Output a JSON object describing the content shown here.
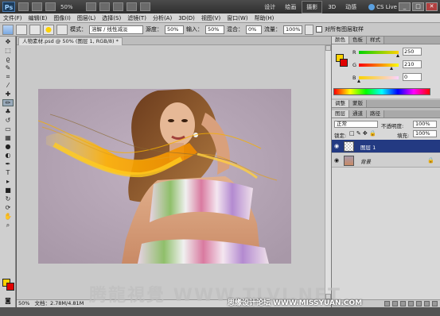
{
  "app": {
    "logo": "Ps",
    "zoom_display": "50%",
    "workspaces": [
      "设计",
      "绘画",
      "摄影",
      "3D",
      "动感"
    ],
    "active_workspace": "摄影",
    "cs_live": "CS Live",
    "window_buttons": [
      "_",
      "□",
      "✕"
    ]
  },
  "menu": [
    "文件(F)",
    "编辑(E)",
    "图像(I)",
    "图层(L)",
    "选择(S)",
    "滤镜(T)",
    "分析(A)",
    "3D(D)",
    "视图(V)",
    "窗口(W)",
    "帮助(H)"
  ],
  "options": {
    "mode_label": "模式：",
    "mode_value": "溶解",
    "mode_value2": "线性减淡（添加）",
    "mode_option": "溶解 / 线性减淡",
    "opacity_label": "源度：",
    "opacity_value": "50%",
    "flow_label": "流量：",
    "flow_value": "100%",
    "fade_label": "混合：",
    "fade_value": "0%",
    "amount_label": "输入：",
    "amount_value": "50%",
    "sample_all_label": "对所有图层取样"
  },
  "document": {
    "tab_label": "人物素材.psd @ 50% (图层 1, RGB/8) *",
    "status_zoom": "50%",
    "status_doc": "文档：2.78M/4.81M"
  },
  "color_panel": {
    "tabs": [
      "颜色",
      "色板",
      "样式"
    ],
    "active_tab": "颜色",
    "r_label": "R",
    "r_value": "250",
    "g_label": "G",
    "g_value": "210",
    "b_label": "B",
    "b_value": "0",
    "fg_color": "#ffd200",
    "bg_color": "#e00000"
  },
  "adjust_panel": {
    "tabs": [
      "调整",
      "蒙版"
    ]
  },
  "layers_panel": {
    "tabs": [
      "图层",
      "通道",
      "路径"
    ],
    "blend_mode": "正常",
    "opacity_label": "不透明度:",
    "opacity_value": "100%",
    "lock_label": "锁定:",
    "fill_label": "填充:",
    "fill_value": "100%",
    "layers": [
      {
        "name": "图层 1",
        "selected": true
      },
      {
        "name": "背景",
        "selected": false,
        "locked": true
      }
    ]
  },
  "watermark": "腾龍視覺 WWW.TLVI.NET",
  "credit": "思缘设计论坛 WWW.MISSYUAN.COM"
}
